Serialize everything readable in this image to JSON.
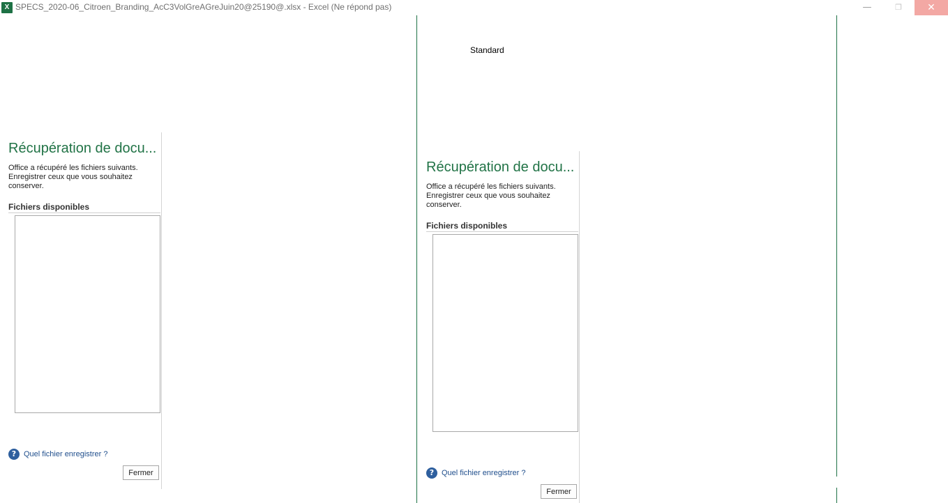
{
  "window": {
    "title": "SPECS_2020-06_Citroen_Branding_AcC3VolGreAGreJuin20@25190@.xlsx - Excel (Ne répond pas)",
    "icon": "X",
    "minimize": "—",
    "maximize": "❐",
    "close": "✕"
  },
  "background_text": "Standard",
  "recovery_pane": {
    "title": "Récupération de docu...",
    "description": "Office a récupéré les fichiers suivants. Enregistrer ceux que vous souhaitez conserver.",
    "available_files_label": "Fichiers disponibles",
    "files": [],
    "help_link": "Quel fichier enregistrer ?",
    "help_icon": "?",
    "close_button": "Fermer"
  },
  "colors": {
    "accent": "#217346",
    "divider_green": "#1e7145",
    "close_hover": "#f3a8a4",
    "link": "#1f4e8c"
  },
  "icons": [
    "excel-app-icon",
    "minimize-icon",
    "maximize-icon",
    "close-icon",
    "help-icon"
  ]
}
